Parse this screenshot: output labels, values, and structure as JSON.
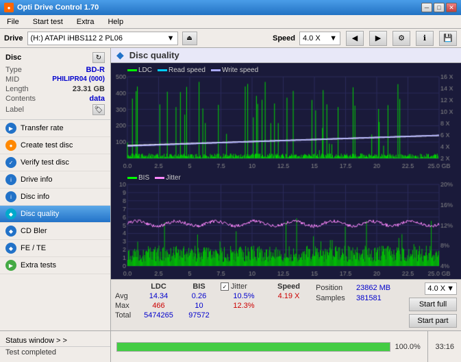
{
  "app": {
    "title": "Opti Drive Control 1.70",
    "icon": "●"
  },
  "titlebar": {
    "minimize": "─",
    "maximize": "□",
    "close": "✕"
  },
  "menu": {
    "items": [
      "File",
      "Start test",
      "Extra",
      "Help"
    ]
  },
  "drive": {
    "label": "Drive",
    "selected": "(H:)  ATAPI iHBS112  2 PL06",
    "speed_label": "Speed",
    "speed_value": "4.0 X"
  },
  "disc": {
    "title": "Disc",
    "type_label": "Type",
    "type_value": "BD-R",
    "mid_label": "MID",
    "mid_value": "PHILIPR04 (000)",
    "length_label": "Length",
    "length_value": "23.31 GB",
    "contents_label": "Contents",
    "contents_value": "data",
    "label_label": "Label"
  },
  "sidebar": {
    "items": [
      {
        "id": "transfer-rate",
        "label": "Transfer rate",
        "icon": "▶",
        "color": "blue"
      },
      {
        "id": "create-test-disc",
        "label": "Create test disc",
        "icon": "●",
        "color": "orange"
      },
      {
        "id": "verify-test-disc",
        "label": "Verify test disc",
        "icon": "✓",
        "color": "blue"
      },
      {
        "id": "drive-info",
        "label": "Drive info",
        "icon": "i",
        "color": "blue"
      },
      {
        "id": "disc-info",
        "label": "Disc info",
        "icon": "i",
        "color": "blue"
      },
      {
        "id": "disc-quality",
        "label": "Disc quality",
        "icon": "◆",
        "color": "cyan",
        "active": true
      },
      {
        "id": "cd-bler",
        "label": "CD Bler",
        "icon": "◆",
        "color": "blue"
      },
      {
        "id": "fe-te",
        "label": "FE / TE",
        "icon": "◆",
        "color": "blue"
      },
      {
        "id": "extra-tests",
        "label": "Extra tests",
        "icon": "▶",
        "color": "green"
      }
    ]
  },
  "disc_quality": {
    "title": "Disc quality",
    "legend": {
      "ldc": "LDC",
      "read_speed": "Read speed",
      "write_speed": "Write speed"
    },
    "legend2": {
      "bis": "BIS",
      "jitter": "Jitter"
    },
    "upper_chart": {
      "y_max": "500",
      "y_vals": [
        "500",
        "400",
        "300",
        "200",
        "100"
      ],
      "y_right": [
        "16 X",
        "14 X",
        "12 X",
        "10 X",
        "8 X",
        "6 X",
        "4 X",
        "2 X"
      ],
      "x_vals": [
        "0.0",
        "2.5",
        "5",
        "7.5",
        "10",
        "12.5",
        "15",
        "17.5",
        "20",
        "22.5",
        "25.0 GB"
      ]
    },
    "lower_chart": {
      "y_vals": [
        "10",
        "9",
        "8",
        "7",
        "6",
        "5",
        "4",
        "3",
        "2",
        "1"
      ],
      "y_right": [
        "20%",
        "16%",
        "12%",
        "8%",
        "4%"
      ],
      "x_vals": [
        "0.0",
        "2.5",
        "5",
        "7.5",
        "10",
        "12.5",
        "15",
        "17.5",
        "20",
        "22.5",
        "25.0 GB"
      ]
    }
  },
  "stats": {
    "headers": [
      "",
      "LDC",
      "BIS",
      "",
      "Jitter",
      "Speed"
    ],
    "avg_label": "Avg",
    "avg_ldc": "14.34",
    "avg_bis": "0.26",
    "avg_jitter": "10.5%",
    "avg_speed": "4.19 X",
    "max_label": "Max",
    "max_ldc": "466",
    "max_bis": "10",
    "max_jitter": "12.3%",
    "total_label": "Total",
    "total_ldc": "5474265",
    "total_bis": "97572",
    "position_label": "Position",
    "position_value": "23862 MB",
    "samples_label": "Samples",
    "samples_value": "381581",
    "speed_option": "4.0 X",
    "start_full": "Start full",
    "start_part": "Start part",
    "jitter_checked": true,
    "jitter_label": "Jitter"
  },
  "statusbar": {
    "status_window": "Status window > >",
    "test_completed": "Test completed",
    "progress": "100.0%",
    "time": "33:16"
  },
  "colors": {
    "ldc_color": "#00ff00",
    "read_speed_color": "#ffffff",
    "write_speed_color": "#aaaaff",
    "bis_color": "#00ff00",
    "jitter_color": "#ff88ff",
    "grid_color": "#2a2a5a",
    "chart_bg": "#1a1a3a",
    "accent_blue": "#2272c8"
  }
}
